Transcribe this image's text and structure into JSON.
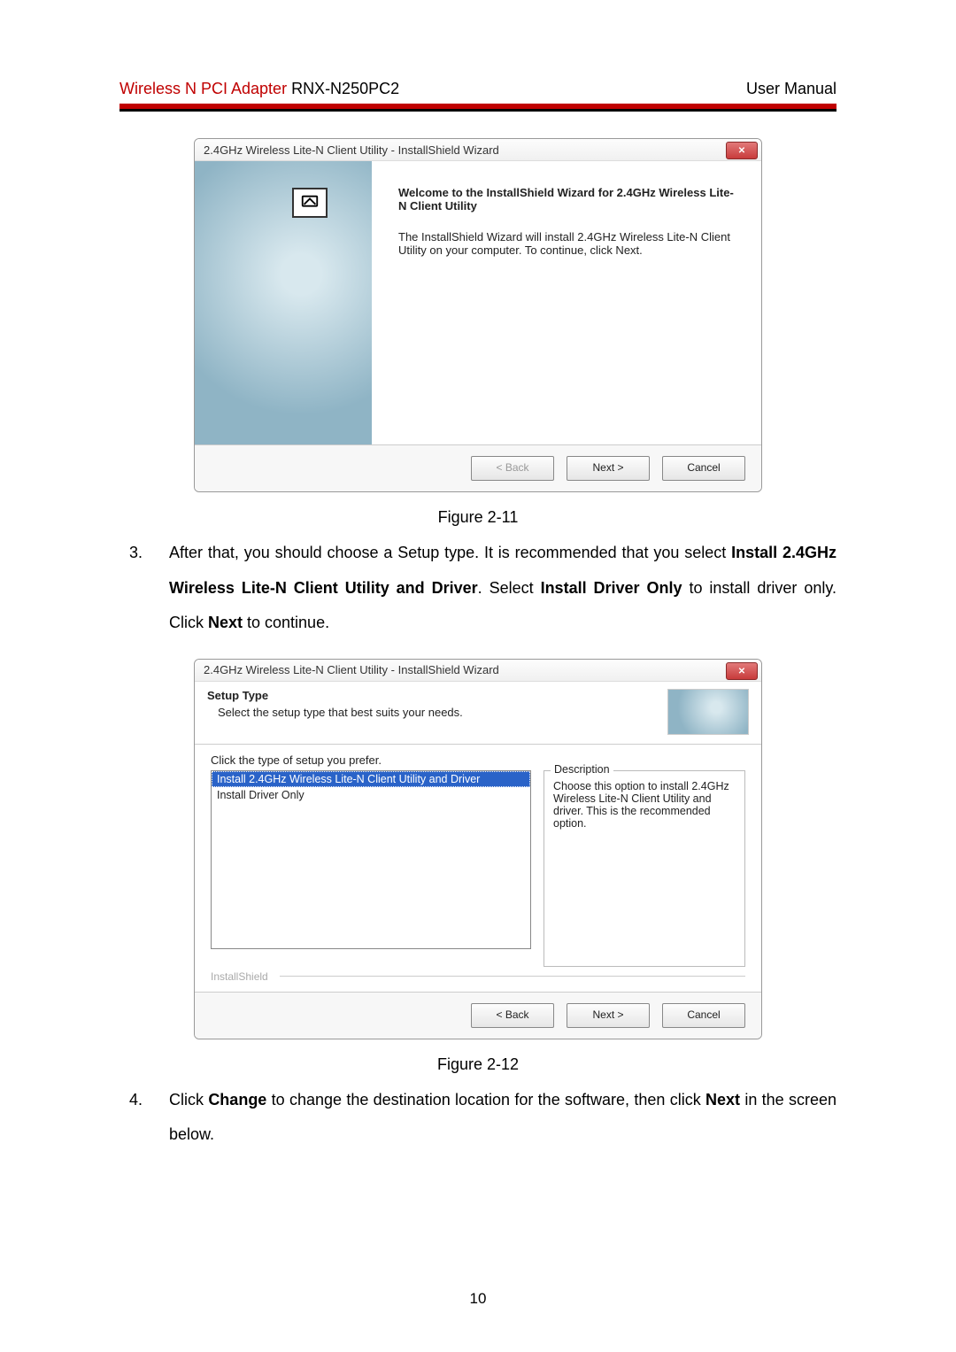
{
  "header": {
    "product_red": "Wireless N PCI Adapter",
    "product_black": " RNX-N250PC2",
    "right": "User Manual"
  },
  "dialog1": {
    "title": "2.4GHz Wireless Lite-N Client Utility - InstallShield Wizard",
    "heading": "Welcome to the InstallShield Wizard for 2.4GHz Wireless Lite-N Client Utility",
    "body": "The InstallShield Wizard will install 2.4GHz Wireless Lite-N Client Utility on your computer.  To continue, click Next.",
    "btn_back": "< Back",
    "btn_next": "Next >",
    "btn_cancel": "Cancel"
  },
  "caption1": "Figure 2-11",
  "step3": {
    "num": "3.",
    "t1": "After that, you should choose a Setup type. It is recommended that you select ",
    "b1": "Install 2.4GHz Wireless Lite-N Client Utility and Driver",
    "t2": ". Select ",
    "b2": "Install Driver Only",
    "t3": " to install driver only. Click ",
    "b3": "Next",
    "t4": " to continue."
  },
  "dialog2": {
    "title": "2.4GHz Wireless Lite-N Client Utility - InstallShield Wizard",
    "heading_bold": "Setup Type",
    "heading_sub": "Select the setup type that best suits your needs.",
    "instruction": "Click the type of setup you prefer.",
    "option_selected": "Install 2.4GHz Wireless Lite-N Client Utility and Driver",
    "option_other": "Install Driver Only",
    "desc_label": "Description",
    "desc_text": "Choose this option to install 2.4GHz Wireless Lite-N Client Utility and driver. This is the recommended option.",
    "brand": "InstallShield",
    "btn_back": "< Back",
    "btn_next": "Next >",
    "btn_cancel": "Cancel"
  },
  "caption2": "Figure 2-12",
  "step4": {
    "num": "4.",
    "t1": "Click ",
    "b1": "Change",
    "t2": " to change the destination location for the software, then click ",
    "b2": "Next",
    "t3": " in the screen below."
  },
  "page_num": "10"
}
